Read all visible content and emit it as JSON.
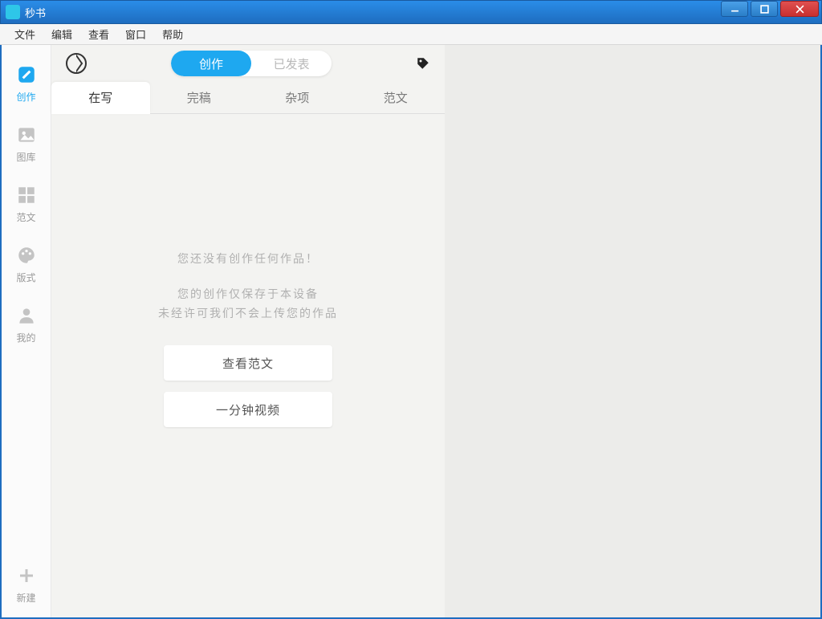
{
  "window": {
    "title": "秒书"
  },
  "menubar": {
    "items": [
      "文件",
      "编辑",
      "查看",
      "窗口",
      "帮助"
    ]
  },
  "sidebar": {
    "items": [
      {
        "label": "创作",
        "icon": "create"
      },
      {
        "label": "图库",
        "icon": "gallery"
      },
      {
        "label": "范文",
        "icon": "templates"
      },
      {
        "label": "版式",
        "icon": "layout"
      },
      {
        "label": "我的",
        "icon": "profile"
      }
    ],
    "new_label": "新建"
  },
  "segmented": {
    "create": "创作",
    "published": "已发表"
  },
  "sub_tabs": {
    "writing": "在写",
    "done": "完稿",
    "misc": "杂项",
    "sample": "范文"
  },
  "empty": {
    "line1": "您还没有创作任何作品！",
    "line2": "您的创作仅保存于本设备",
    "line3": "未经许可我们不会上传您的作品",
    "btn_sample": "查看范文",
    "btn_video": "一分钟视频"
  }
}
